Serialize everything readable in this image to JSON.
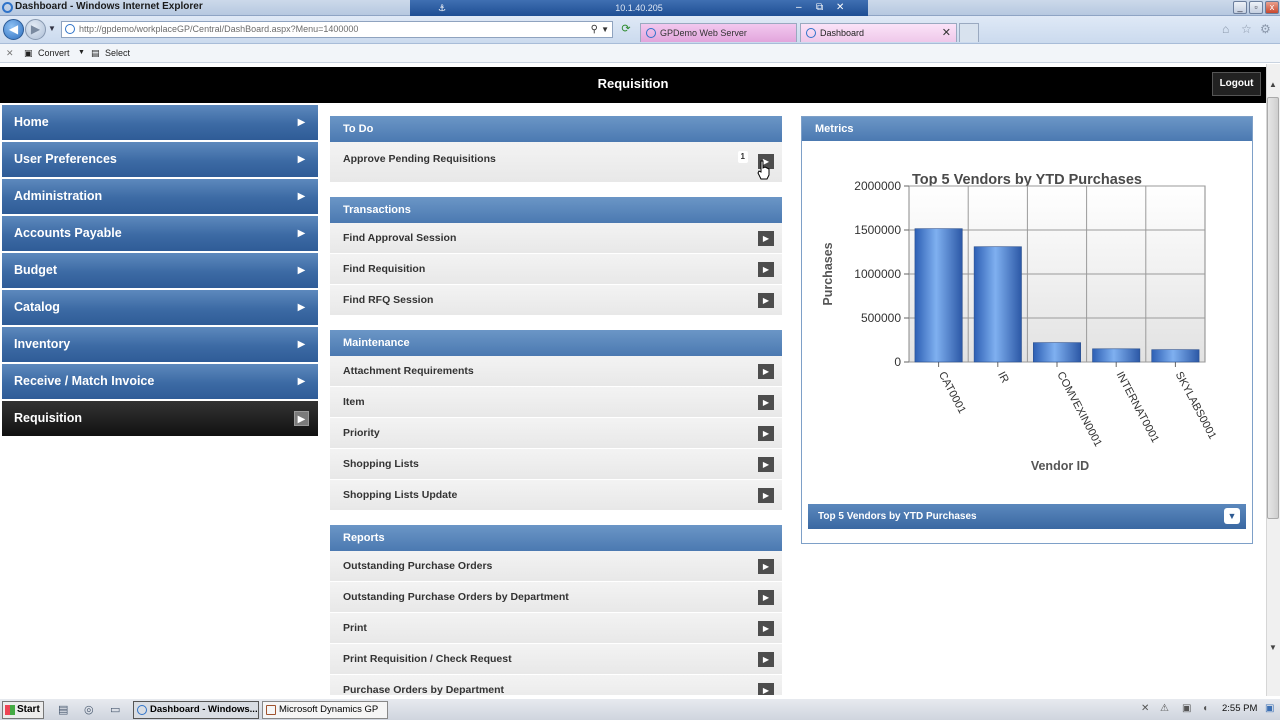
{
  "window": {
    "title": "Dashboard - Windows Internet Explorer",
    "remote_host": "10.1.40.205",
    "remote_pin": "⚓"
  },
  "browser": {
    "url": "http://gpdemo/workplaceGP/Central/DashBoard.aspx?Menu=1400000",
    "tabs": [
      {
        "label": "GPDemo Web Server"
      },
      {
        "label": "Dashboard"
      }
    ],
    "commands": {
      "convert": "Convert",
      "select": "Select"
    }
  },
  "header": {
    "title": "Requisition",
    "logout_label": "Logout"
  },
  "sidebar": {
    "items": [
      {
        "label": "Home"
      },
      {
        "label": "User Preferences"
      },
      {
        "label": "Administration"
      },
      {
        "label": "Accounts Payable"
      },
      {
        "label": "Budget"
      },
      {
        "label": "Catalog"
      },
      {
        "label": "Inventory"
      },
      {
        "label": "Receive / Match Invoice"
      },
      {
        "label": "Requisition"
      }
    ],
    "active_index": 8
  },
  "todo": {
    "title": "To Do",
    "items": [
      {
        "label": "Approve Pending Requisitions",
        "count": "1"
      }
    ]
  },
  "transactions": {
    "title": "Transactions",
    "items": [
      {
        "label": "Find Approval Session"
      },
      {
        "label": "Find Requisition"
      },
      {
        "label": "Find RFQ Session"
      }
    ]
  },
  "maintenance": {
    "title": "Maintenance",
    "items": [
      {
        "label": "Attachment Requirements"
      },
      {
        "label": "Item"
      },
      {
        "label": "Priority"
      },
      {
        "label": "Shopping Lists"
      },
      {
        "label": "Shopping Lists Update"
      }
    ]
  },
  "reports": {
    "title": "Reports",
    "items": [
      {
        "label": "Outstanding Purchase Orders"
      },
      {
        "label": "Outstanding Purchase Orders by Department"
      },
      {
        "label": "Print"
      },
      {
        "label": "Print Requisition / Check Request"
      },
      {
        "label": "Purchase Orders by Department"
      }
    ]
  },
  "metrics": {
    "title": "Metrics",
    "footer_label": "Top 5 Vendors by YTD Purchases"
  },
  "chart_data": {
    "type": "bar",
    "title": "Top 5 Vendors by YTD Purchases",
    "xlabel": "Vendor ID",
    "ylabel": "Purchases",
    "categories": [
      "CAT0001",
      "IR",
      "COMVEXIN0001",
      "INTERNAT0001",
      "SKYLABS0001"
    ],
    "values": [
      1515000,
      1310000,
      220000,
      150000,
      140000
    ],
    "ylim": [
      0,
      2000000
    ],
    "yticks": [
      "0",
      "500000",
      "1000000",
      "1500000",
      "2000000"
    ],
    "grid": true,
    "bar_color": "#4b84d6"
  },
  "taskbar": {
    "start_label": "Start",
    "buttons": [
      {
        "label": "Dashboard - Windows..."
      },
      {
        "label": "Microsoft Dynamics GP"
      }
    ],
    "clock": "2:55 PM"
  }
}
